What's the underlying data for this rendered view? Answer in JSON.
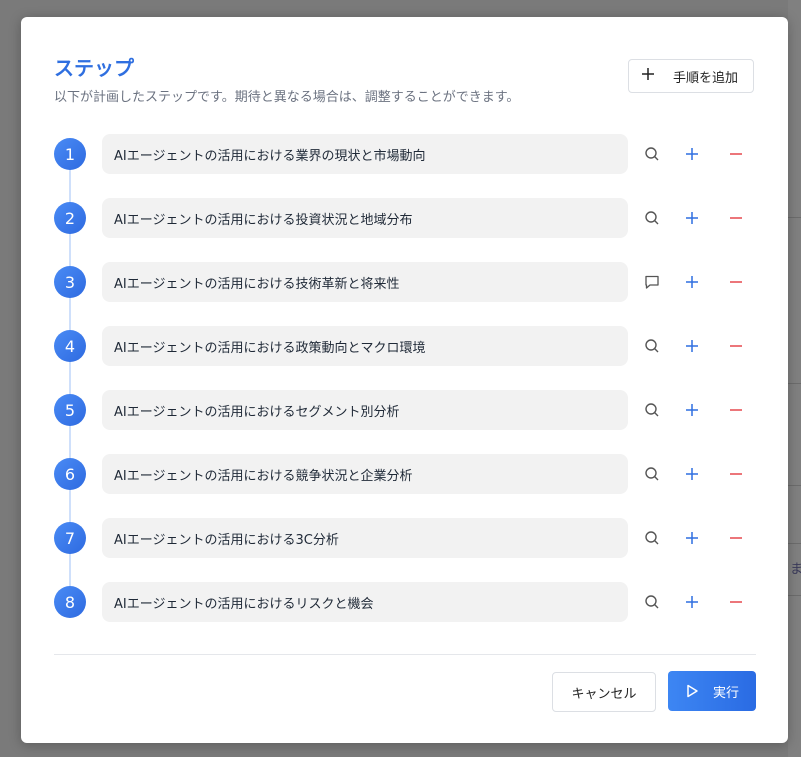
{
  "dialog": {
    "title": "ステップ",
    "subtitle": "以下が計画したステップです。期待と異なる場合は、調整することができます。",
    "add_step_label": "手順を追加",
    "cancel_label": "キャンセル",
    "run_label": "実行"
  },
  "steps": [
    {
      "number": "1",
      "text": "AIエージェントの活用における業界の現状と市場動向",
      "tool_icon": "search-icon"
    },
    {
      "number": "2",
      "text": "AIエージェントの活用における投資状況と地域分布",
      "tool_icon": "search-icon"
    },
    {
      "number": "3",
      "text": "AIエージェントの活用における技術革新と将来性",
      "tool_icon": "chat-icon"
    },
    {
      "number": "4",
      "text": "AIエージェントの活用における政策動向とマクロ環境",
      "tool_icon": "search-icon"
    },
    {
      "number": "5",
      "text": "AIエージェントの活用におけるセグメント別分析",
      "tool_icon": "search-icon"
    },
    {
      "number": "6",
      "text": "AIエージェントの活用における競争状況と企業分析",
      "tool_icon": "search-icon"
    },
    {
      "number": "7",
      "text": "AIエージェントの活用における3C分析",
      "tool_icon": "search-icon"
    },
    {
      "number": "8",
      "text": "AIエージェントの活用におけるリスクと機会",
      "tool_icon": "search-icon"
    }
  ],
  "colors": {
    "accent": "#2f6fe0",
    "remove": "#e5484d",
    "field_bg": "#f2f2f2"
  },
  "background": {
    "partial_text": "ま"
  }
}
